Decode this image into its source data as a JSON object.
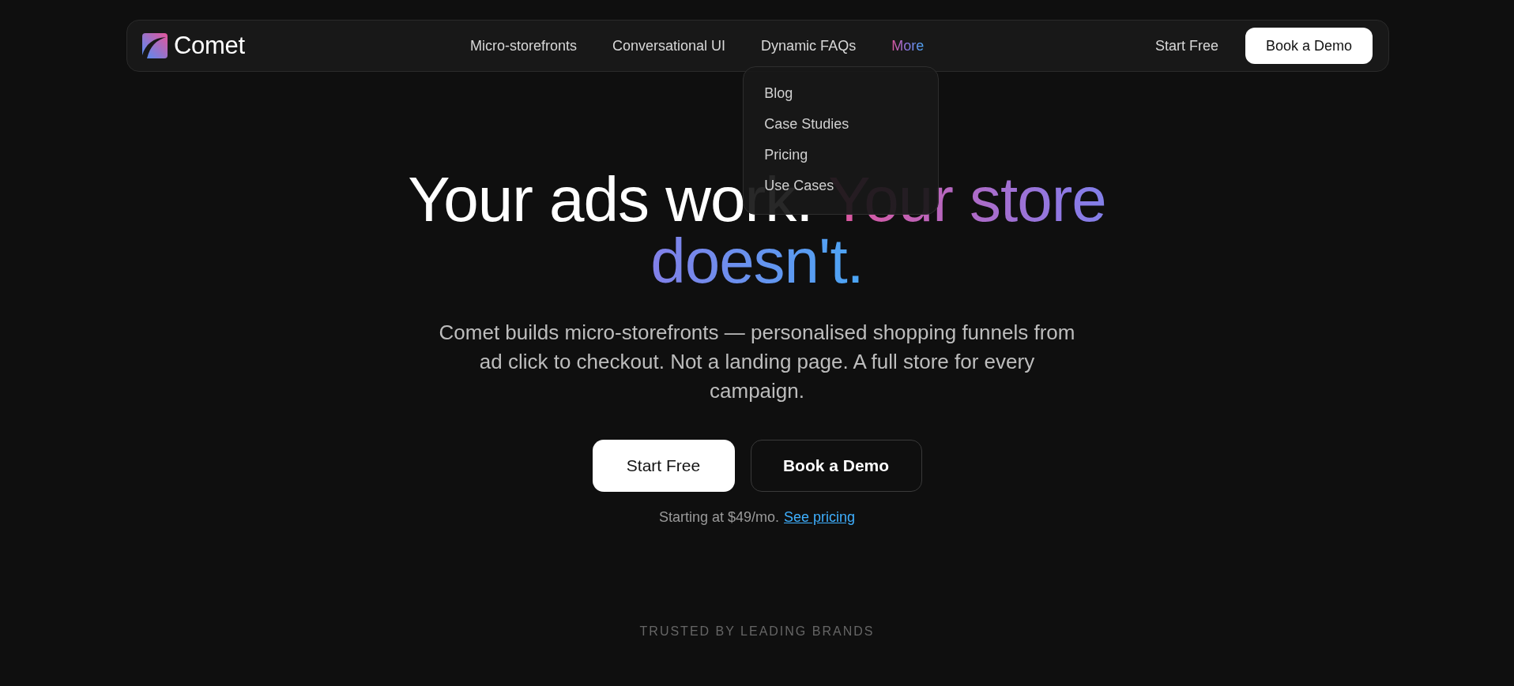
{
  "nav": {
    "brand": "Comet",
    "links": [
      {
        "label": "Micro-storefronts",
        "kind": "link"
      },
      {
        "label": "Conversational UI",
        "kind": "link"
      },
      {
        "label": "Dynamic FAQs",
        "kind": "link"
      },
      {
        "label": "More",
        "kind": "menu",
        "expanded": true,
        "items": [
          "Blog",
          "Case Studies",
          "Pricing",
          "Use Cases"
        ]
      }
    ],
    "start_free": "Start Free",
    "book_demo": "Book a Demo"
  },
  "hero": {
    "headline": [
      {
        "text": "Your ads work.",
        "kind": "plain"
      },
      {
        "text": "Your store doesn't.",
        "kind": "gradient"
      }
    ],
    "description": "Comet builds micro-storefronts — personalised shopping funnels from ad click to checkout. Not a landing page. A full store for every campaign.",
    "buttons": [
      {
        "label": "Start Free",
        "kind": "primary"
      },
      {
        "label": "Book a Demo",
        "kind": "secondary"
      }
    ],
    "pricing_note": "Starting at $49/mo.",
    "pricing_link": "See pricing"
  },
  "trusted_label": "TRUSTED BY LEADING BRANDS"
}
